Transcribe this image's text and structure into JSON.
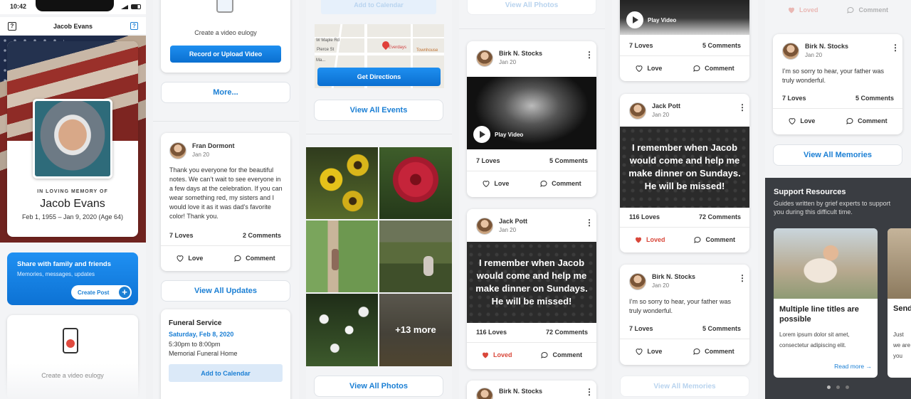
{
  "phone": {
    "time": "10:42",
    "title": "Jacob Evans",
    "help_icon": "?"
  },
  "memorial": {
    "subtitle": "IN LOVING MEMORY OF",
    "name": "Jacob Evans",
    "dates": "Feb 1, 1955 – Jan 9, 2020 (Age 64)"
  },
  "share": {
    "title": "Share with family and friends",
    "subtitle": "Memories, messages, updates",
    "button": "Create Post"
  },
  "video_eulogy": {
    "label": "Create a video eulogy",
    "button": "Record or Upload Video"
  },
  "more_button": "More...",
  "updates": {
    "author": "Fran Dormont",
    "date": "Jan 20",
    "text": "Thank you everyone for the beautiful notes. We can’t wait to see everyone in a few days at the celebration. If you can wear something red, my sisters and I would love it as it was dad’s favorite color! Thank you.",
    "loves": "7 Loves",
    "comments": "2 Comments",
    "love": "Love",
    "comment": "Comment",
    "view_all": "View All Updates"
  },
  "event": {
    "title": "Funeral Service",
    "date": "Saturday, Feb 8, 2020",
    "time": "5:30pm to 8:00pm",
    "place": "Memorial Funeral Home",
    "add_calendar": "Add to Calendar"
  },
  "map": {
    "add_calendar": "Add to Calendar",
    "streets": [
      "W Maple Rd",
      "Pierce St",
      "Everdays",
      "Townhouse",
      "Ma..."
    ],
    "get_directions": "Get Directions",
    "view_all_events": "View All Events"
  },
  "photos": {
    "more": "+13 more",
    "view_all": "View All Photos",
    "view_all_top": "View All Photos"
  },
  "memories_col4": [
    {
      "author": "Birk N. Stocks",
      "date": "Jan 20",
      "play": "Play Video",
      "loves": "7 Loves",
      "comments": "5 Comments",
      "love": "Love",
      "comment": "Comment"
    },
    {
      "author": "Jack Pott",
      "date": "Jan 20",
      "quote": "I remember when Jacob would come and help me make dinner on Sundays. He will be missed!",
      "loves": "116 Loves",
      "comments": "72 Comments",
      "love": "Loved",
      "comment": "Comment"
    },
    {
      "author": "Birk N. Stocks"
    }
  ],
  "memories_col5": [
    {
      "play": "Play Video",
      "loves": "7 Loves",
      "comments": "5 Comments",
      "love": "Love",
      "comment": "Comment"
    },
    {
      "author": "Jack Pott",
      "date": "Jan 20",
      "quote": "I remember when Jacob would come and help me make dinner on Sundays. He will be missed!",
      "loves": "116 Loves",
      "comments": "72 Comments",
      "love": "Loved",
      "comment": "Comment"
    },
    {
      "author": "Birk N. Stocks",
      "date": "Jan 20",
      "text": "I’m so sorry to hear, your father was truly wonderful.",
      "loves": "7 Loves",
      "comments": "5 Comments",
      "love": "Love",
      "comment": "Comment"
    },
    {
      "view_all": "View All Memories"
    }
  ],
  "memories_col6": {
    "top_love": "Loved",
    "top_comment": "Comment",
    "author": "Birk N. Stocks",
    "date": "Jan 20",
    "text": "I’m so sorry to hear, your father was truly wonderful.",
    "loves": "7 Loves",
    "comments": "5 Comments",
    "love": "Love",
    "comment": "Comment",
    "view_all": "View All Memories"
  },
  "support": {
    "title": "Support Resources",
    "subtitle": "Guides written by grief experts to support you during this difficult time.",
    "card_title": "Multiple line titles are possible",
    "card_text": "Lorem ipsum dolor sit amet, consectetur adipiscing elit.",
    "read_more": "Read more →",
    "card2_title": "Send",
    "card2_text": "Just we are you"
  },
  "colors": {
    "accent": "#1b7fd4",
    "loved": "#d9473a",
    "dark": "#3a3d42"
  }
}
